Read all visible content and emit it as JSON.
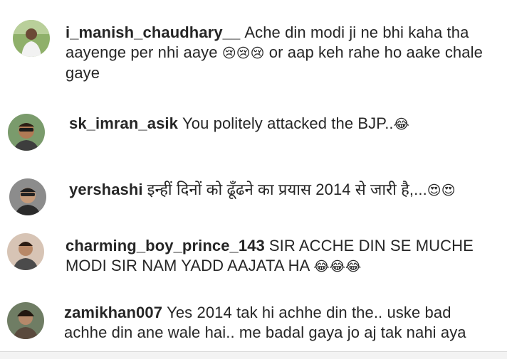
{
  "comments": [
    {
      "username": "i_manish_chaudhary__",
      "text": "Ache din modi ji ne bhi kaha tha aayenge per nhi aaye",
      "emoji": "😢😢😢",
      "text_after": "or aap keh rahe ho aake chale gaye"
    },
    {
      "username": "sk_imran_asik",
      "text": "You politely attacked the BJP..",
      "emoji": "😂"
    },
    {
      "username": "yershashi",
      "text": "इन्हीं दिनों को ढूँढने का प्रयास 2014 से जारी है,...",
      "emoji": "😍😍"
    },
    {
      "username": "charming_boy_prince_143",
      "text": "SIR ACCHE DIN SE MUCHE MODI SIR NAM YADD AAJATA HA",
      "emoji": "😂😂😂"
    },
    {
      "username": "zamikhan007",
      "text": "Yes 2014 tak hi achhe din the.. uske bad achhe din ane wale hai.. me badal gaya jo aj tak nahi aya",
      "emoji": ""
    }
  ]
}
